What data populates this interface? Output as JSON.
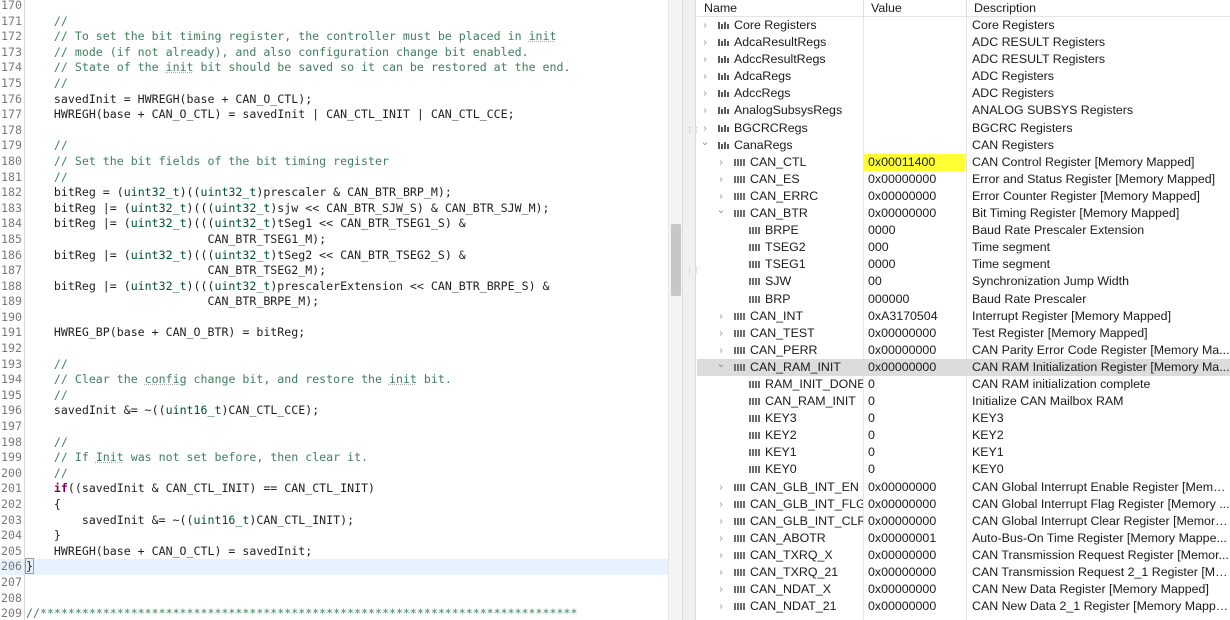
{
  "editor": {
    "lines": [
      {
        "n": "170",
        "t": [
          [
            "",
            ""
          ]
        ]
      },
      {
        "n": "171",
        "t": [
          [
            "c",
            "    //"
          ]
        ]
      },
      {
        "n": "172",
        "t": [
          [
            "c",
            "    // To set the bit timing register, the controller must be placed in "
          ],
          [
            "u",
            "init"
          ]
        ]
      },
      {
        "n": "173",
        "t": [
          [
            "c",
            "    // mode (if not already), and also configuration change bit enabled."
          ]
        ]
      },
      {
        "n": "174",
        "t": [
          [
            "c",
            "    // State of the "
          ],
          [
            "u",
            "init"
          ],
          [
            "c",
            " bit should be saved so it can be restored at the end."
          ]
        ]
      },
      {
        "n": "175",
        "t": [
          [
            "c",
            "    //"
          ]
        ]
      },
      {
        "n": "176",
        "t": [
          [
            "",
            "    savedInit = HWREGH(base + CAN_O_CTL);"
          ]
        ]
      },
      {
        "n": "177",
        "t": [
          [
            "",
            "    HWREGH(base + CAN_O_CTL) = savedInit | CAN_CTL_INIT | CAN_CTL_CCE;"
          ]
        ]
      },
      {
        "n": "178",
        "t": [
          [
            "",
            ""
          ]
        ]
      },
      {
        "n": "179",
        "t": [
          [
            "c",
            "    //"
          ]
        ]
      },
      {
        "n": "180",
        "t": [
          [
            "c",
            "    // Set the bit fields of the bit timing register"
          ]
        ]
      },
      {
        "n": "181",
        "t": [
          [
            "c",
            "    //"
          ]
        ]
      },
      {
        "n": "182",
        "t": [
          [
            "",
            "    bitReg = ("
          ],
          [
            "t",
            "uint32_t"
          ],
          [
            "",
            ")(("
          ],
          [
            "t",
            "uint32_t"
          ],
          [
            "",
            ")prescaler & CAN_BTR_BRP_M);"
          ]
        ]
      },
      {
        "n": "183",
        "t": [
          [
            "",
            "    bitReg |= ("
          ],
          [
            "t",
            "uint32_t"
          ],
          [
            "",
            ")((("
          ],
          [
            "t",
            "uint32_t"
          ],
          [
            "",
            ")sjw << CAN_BTR_SJW_S) & CAN_BTR_SJW_M);"
          ]
        ]
      },
      {
        "n": "184",
        "t": [
          [
            "",
            "    bitReg |= ("
          ],
          [
            "t",
            "uint32_t"
          ],
          [
            "",
            ")((("
          ],
          [
            "t",
            "uint32_t"
          ],
          [
            "",
            ")tSeg1 << CAN_BTR_TSEG1_S) &"
          ]
        ]
      },
      {
        "n": "185",
        "t": [
          [
            "",
            "                          CAN_BTR_TSEG1_M);"
          ]
        ]
      },
      {
        "n": "186",
        "t": [
          [
            "",
            "    bitReg |= ("
          ],
          [
            "t",
            "uint32_t"
          ],
          [
            "",
            ")((("
          ],
          [
            "t",
            "uint32_t"
          ],
          [
            "",
            ")tSeg2 << CAN_BTR_TSEG2_S) &"
          ]
        ]
      },
      {
        "n": "187",
        "t": [
          [
            "",
            "                          CAN_BTR_TSEG2_M);"
          ]
        ]
      },
      {
        "n": "188",
        "t": [
          [
            "",
            "    bitReg |= ("
          ],
          [
            "t",
            "uint32_t"
          ],
          [
            "",
            ")((("
          ],
          [
            "t",
            "uint32_t"
          ],
          [
            "",
            ")prescalerExtension << CAN_BTR_BRPE_S) &"
          ]
        ]
      },
      {
        "n": "189",
        "t": [
          [
            "",
            "                          CAN_BTR_BRPE_M);"
          ]
        ]
      },
      {
        "n": "190",
        "t": [
          [
            "",
            ""
          ]
        ]
      },
      {
        "n": "191",
        "t": [
          [
            "",
            "    HWREG_BP(base + CAN_O_BTR) = bitReg;"
          ]
        ]
      },
      {
        "n": "192",
        "t": [
          [
            "",
            ""
          ]
        ]
      },
      {
        "n": "193",
        "t": [
          [
            "c",
            "    //"
          ]
        ]
      },
      {
        "n": "194",
        "t": [
          [
            "c",
            "    // Clear the "
          ],
          [
            "u",
            "config"
          ],
          [
            "c",
            " change bit, and restore the "
          ],
          [
            "u",
            "init"
          ],
          [
            "c",
            " bit."
          ]
        ]
      },
      {
        "n": "195",
        "t": [
          [
            "c",
            "    //"
          ]
        ]
      },
      {
        "n": "196",
        "t": [
          [
            "",
            "    savedInit &= ~(("
          ],
          [
            "t",
            "uint16_t"
          ],
          [
            "",
            ")CAN_CTL_CCE);"
          ]
        ]
      },
      {
        "n": "197",
        "t": [
          [
            "",
            ""
          ]
        ]
      },
      {
        "n": "198",
        "t": [
          [
            "c",
            "    //"
          ]
        ]
      },
      {
        "n": "199",
        "t": [
          [
            "c",
            "    // If "
          ],
          [
            "u",
            "Init"
          ],
          [
            "c",
            " was not set before, then clear it."
          ]
        ]
      },
      {
        "n": "200",
        "t": [
          [
            "c",
            "    //"
          ]
        ]
      },
      {
        "n": "201",
        "t": [
          [
            "",
            "    "
          ],
          [
            "k",
            "if"
          ],
          [
            "",
            "((savedInit & CAN_CTL_INIT) == CAN_CTL_INIT)"
          ]
        ]
      },
      {
        "n": "202",
        "t": [
          [
            "",
            "    {"
          ]
        ]
      },
      {
        "n": "203",
        "t": [
          [
            "",
            "        savedInit &= ~(("
          ],
          [
            "t",
            "uint16_t"
          ],
          [
            "",
            ")CAN_CTL_INIT);"
          ]
        ]
      },
      {
        "n": "204",
        "t": [
          [
            "",
            "    }"
          ]
        ]
      },
      {
        "n": "205",
        "t": [
          [
            "",
            "    HWREGH(base + CAN_O_CTL) = savedInit;"
          ]
        ]
      },
      {
        "n": "206",
        "t": [
          [
            "b",
            "}"
          ]
        ],
        "current": true
      },
      {
        "n": "207",
        "t": [
          [
            "",
            ""
          ]
        ]
      },
      {
        "n": "208",
        "t": [
          [
            "",
            ""
          ]
        ]
      },
      {
        "n": "209",
        "t": [
          [
            "c",
            "//*****************************************************************************"
          ]
        ]
      }
    ]
  },
  "registers": {
    "columns": {
      "name": "Name",
      "value": "Value",
      "description": "Description"
    },
    "rows": [
      {
        "level": 0,
        "icon": "register-group",
        "toggle": "collapsed",
        "name": "Core Registers",
        "value": "",
        "desc": "Core Registers"
      },
      {
        "level": 0,
        "icon": "register-group",
        "toggle": "collapsed",
        "name": "AdcaResultRegs",
        "value": "",
        "desc": "ADC RESULT Registers"
      },
      {
        "level": 0,
        "icon": "register-group",
        "toggle": "collapsed",
        "name": "AdccResultRegs",
        "value": "",
        "desc": "ADC RESULT Registers"
      },
      {
        "level": 0,
        "icon": "register-group",
        "toggle": "collapsed",
        "name": "AdcaRegs",
        "value": "",
        "desc": "ADC Registers"
      },
      {
        "level": 0,
        "icon": "register-group",
        "toggle": "collapsed",
        "name": "AdccRegs",
        "value": "",
        "desc": "ADC Registers"
      },
      {
        "level": 0,
        "icon": "register-group",
        "toggle": "collapsed",
        "name": "AnalogSubsysRegs",
        "value": "",
        "desc": "ANALOG SUBSYS Registers"
      },
      {
        "level": 0,
        "icon": "register-group",
        "toggle": "collapsed",
        "name": "BGCRCRegs",
        "value": "",
        "desc": "BGCRC Registers"
      },
      {
        "level": 0,
        "icon": "register-group",
        "toggle": "expanded",
        "name": "CanaRegs",
        "value": "",
        "desc": "CAN Registers"
      },
      {
        "level": 1,
        "icon": "register",
        "toggle": "collapsed",
        "name": "CAN_CTL",
        "value": "0x00011400",
        "desc": "CAN Control Register [Memory Mapped]",
        "highlight": true
      },
      {
        "level": 1,
        "icon": "register",
        "toggle": "collapsed",
        "name": "CAN_ES",
        "value": "0x00000000",
        "desc": "Error and Status Register [Memory Mapped]"
      },
      {
        "level": 1,
        "icon": "register",
        "toggle": "collapsed",
        "name": "CAN_ERRC",
        "value": "0x00000000",
        "desc": "Error Counter Register [Memory Mapped]"
      },
      {
        "level": 1,
        "icon": "register",
        "toggle": "expanded",
        "name": "CAN_BTR",
        "value": "0x00000000",
        "desc": "Bit Timing Register [Memory Mapped]"
      },
      {
        "level": 2,
        "icon": "field",
        "toggle": "none",
        "name": "BRPE",
        "value": "0000",
        "desc": "Baud Rate Prescaler Extension"
      },
      {
        "level": 2,
        "icon": "field",
        "toggle": "none",
        "name": "TSEG2",
        "value": "000",
        "desc": "Time segment"
      },
      {
        "level": 2,
        "icon": "field",
        "toggle": "none",
        "name": "TSEG1",
        "value": "0000",
        "desc": "Time segment"
      },
      {
        "level": 2,
        "icon": "field",
        "toggle": "none",
        "name": "SJW",
        "value": "00",
        "desc": "Synchronization Jump Width"
      },
      {
        "level": 2,
        "icon": "field",
        "toggle": "none",
        "name": "BRP",
        "value": "000000",
        "desc": "Baud Rate Prescaler"
      },
      {
        "level": 1,
        "icon": "register",
        "toggle": "collapsed",
        "name": "CAN_INT",
        "value": "0xA3170504",
        "desc": "Interrupt Register [Memory Mapped]"
      },
      {
        "level": 1,
        "icon": "register",
        "toggle": "collapsed",
        "name": "CAN_TEST",
        "value": "0x00000000",
        "desc": "Test Register [Memory Mapped]"
      },
      {
        "level": 1,
        "icon": "register",
        "toggle": "collapsed",
        "name": "CAN_PERR",
        "value": "0x00000000",
        "desc": "CAN Parity Error Code Register  [Memory Ma..."
      },
      {
        "level": 1,
        "icon": "register",
        "toggle": "expanded",
        "name": "CAN_RAM_INIT",
        "value": "0x00000000",
        "desc": "CAN RAM Initialization Register [Memory Ma...",
        "selected": true
      },
      {
        "level": 2,
        "icon": "field",
        "toggle": "none",
        "name": "RAM_INIT_DONE",
        "value": "0",
        "desc": "CAN RAM initialization complete"
      },
      {
        "level": 2,
        "icon": "field",
        "toggle": "none",
        "name": "CAN_RAM_INIT",
        "value": "0",
        "desc": "Initialize CAN Mailbox RAM"
      },
      {
        "level": 2,
        "icon": "field",
        "toggle": "none",
        "name": "KEY3",
        "value": "0",
        "desc": "KEY3"
      },
      {
        "level": 2,
        "icon": "field",
        "toggle": "none",
        "name": "KEY2",
        "value": "0",
        "desc": "KEY2"
      },
      {
        "level": 2,
        "icon": "field",
        "toggle": "none",
        "name": "KEY1",
        "value": "0",
        "desc": "KEY1"
      },
      {
        "level": 2,
        "icon": "field",
        "toggle": "none",
        "name": "KEY0",
        "value": "0",
        "desc": "KEY0"
      },
      {
        "level": 1,
        "icon": "register",
        "toggle": "collapsed",
        "name": "CAN_GLB_INT_EN",
        "value": "0x00000000",
        "desc": "CAN Global Interrupt Enable Register [Memo..."
      },
      {
        "level": 1,
        "icon": "register",
        "toggle": "collapsed",
        "name": "CAN_GLB_INT_FLG",
        "value": "0x00000000",
        "desc": "CAN Global Interrupt Flag Register [Memory ..."
      },
      {
        "level": 1,
        "icon": "register",
        "toggle": "collapsed",
        "name": "CAN_GLB_INT_CLR",
        "value": "0x00000000",
        "desc": "CAN Global Interrupt Clear Register [Memory..."
      },
      {
        "level": 1,
        "icon": "register",
        "toggle": "collapsed",
        "name": "CAN_ABOTR",
        "value": "0x00000001",
        "desc": "Auto-Bus-On Time Register [Memory Mappe..."
      },
      {
        "level": 1,
        "icon": "register",
        "toggle": "collapsed",
        "name": "CAN_TXRQ_X",
        "value": "0x00000000",
        "desc": "CAN Transmission Request Register [Memor..."
      },
      {
        "level": 1,
        "icon": "register",
        "toggle": "collapsed",
        "name": "CAN_TXRQ_21",
        "value": "0x00000000",
        "desc": "CAN Transmission Request 2_1 Register [Me..."
      },
      {
        "level": 1,
        "icon": "register",
        "toggle": "collapsed",
        "name": "CAN_NDAT_X",
        "value": "0x00000000",
        "desc": "CAN New Data Register [Memory Mapped]"
      },
      {
        "level": 1,
        "icon": "register",
        "toggle": "collapsed",
        "name": "CAN_NDAT_21",
        "value": "0x00000000",
        "desc": "CAN New Data 2_1 Register [Memory Mappe..."
      }
    ]
  },
  "colors": {
    "value_highlight": "#ffff33",
    "selected_row": "#dcdcdc",
    "comment": "#3f7f5f",
    "keyword": "#7f0055",
    "type": "#005032",
    "current_line": "#e8f2fe"
  }
}
